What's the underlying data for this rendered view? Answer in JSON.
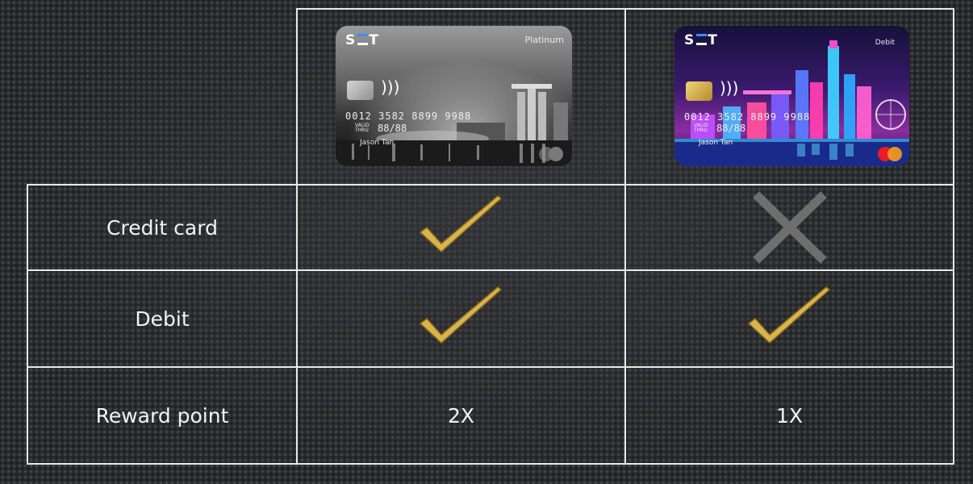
{
  "cards": [
    {
      "brand_left": "S",
      "brand_right": "T",
      "tier": "Platinum",
      "number": "0012 3582 8899 9988",
      "valid_label": "VALID THRU",
      "expiry": "88/88",
      "holder": "Jason Tan",
      "style": "monochrome"
    },
    {
      "brand_left": "S",
      "brand_right": "T",
      "tier": "Debit",
      "number": "0012 3582 8899 9988",
      "valid_label": "VALID THRU",
      "expiry": "88/88",
      "holder": "Jason Tan",
      "style": "neon"
    }
  ],
  "rows": [
    {
      "feature": "Credit card",
      "col1": "check-icon",
      "col2": "cross-icon"
    },
    {
      "feature": "Debit",
      "col1": "check-icon",
      "col2": "check-icon"
    },
    {
      "feature": "Reward point",
      "col1_text": "2X",
      "col2_text": "1X"
    }
  ],
  "colors": {
    "grid_line": "#e9e9e9",
    "check_gold": "#d9b44a",
    "cross_gray": "#6e6e6e",
    "text": "#f2f2f2"
  }
}
